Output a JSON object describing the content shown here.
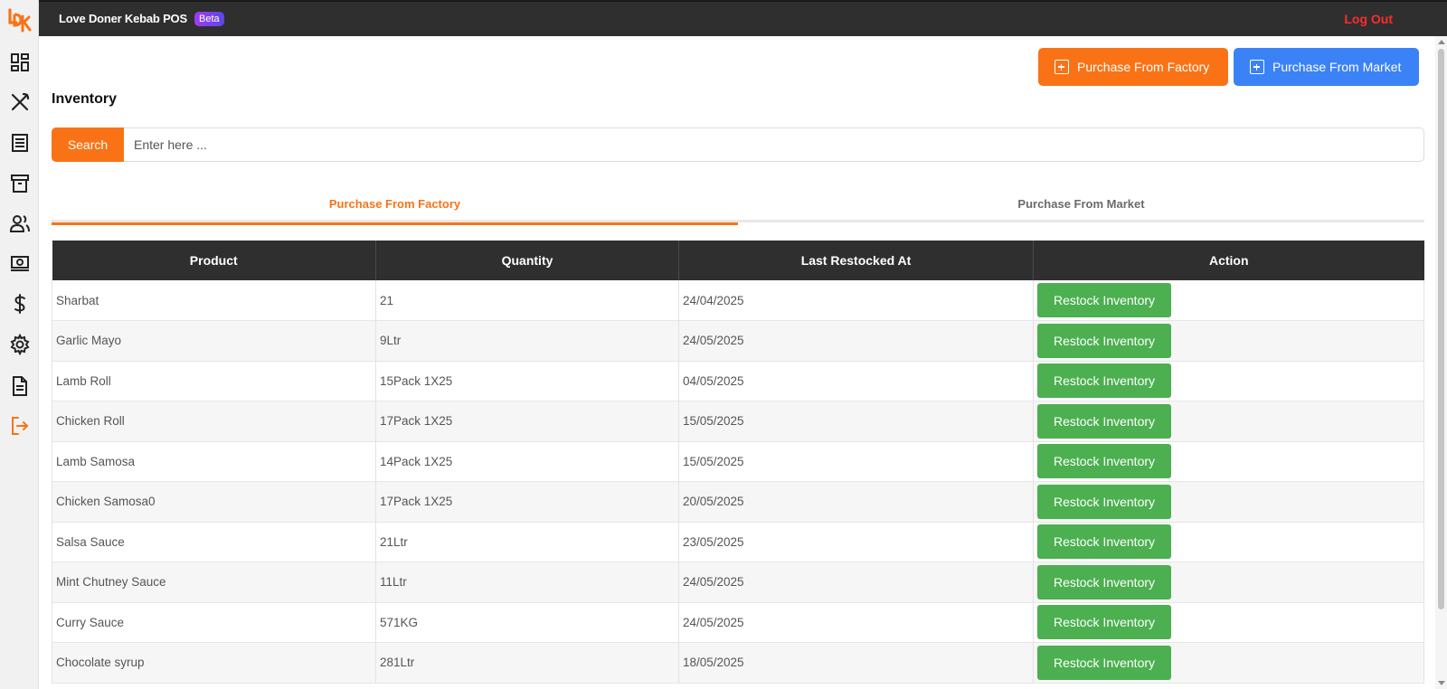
{
  "header": {
    "app_title": "Love Doner Kebab POS",
    "beta_badge": "Beta",
    "logout_label": "Log Out"
  },
  "sidebar": {
    "logo_text": "LDK",
    "icons": [
      "dashboard-icon",
      "utensils-icon",
      "receipt-icon",
      "archive-icon",
      "users-icon",
      "cash-icon",
      "dollar-icon",
      "settings-icon",
      "document-icon",
      "logout-icon"
    ]
  },
  "actions": {
    "purchase_factory": "Purchase From Factory",
    "purchase_market": "Purchase From Market"
  },
  "page": {
    "title": "Inventory"
  },
  "search": {
    "button_label": "Search",
    "placeholder": "Enter here ..."
  },
  "tabs": [
    {
      "label": "Purchase From Factory",
      "active": true
    },
    {
      "label": "Purchase From Market",
      "active": false
    }
  ],
  "table": {
    "headers": [
      "Product",
      "Quantity",
      "Last Restocked At",
      "Action"
    ],
    "rows": [
      {
        "product": "Sharbat",
        "quantity": "21",
        "date": "24/04/2025",
        "action": "Restock Inventory"
      },
      {
        "product": "Garlic Mayo",
        "quantity": "9Ltr",
        "date": "24/05/2025",
        "action": "Restock Inventory"
      },
      {
        "product": "Lamb Roll",
        "quantity": "15Pack 1X25",
        "date": "04/05/2025",
        "action": "Restock Inventory"
      },
      {
        "product": "Chicken Roll",
        "quantity": "17Pack 1X25",
        "date": "15/05/2025",
        "action": "Restock Inventory"
      },
      {
        "product": "Lamb Samosa",
        "quantity": "14Pack 1X25",
        "date": "15/05/2025",
        "action": "Restock Inventory"
      },
      {
        "product": "Chicken Samosa0",
        "quantity": "17Pack 1X25",
        "date": "20/05/2025",
        "action": "Restock Inventory"
      },
      {
        "product": "Salsa Sauce",
        "quantity": "21Ltr",
        "date": "23/05/2025",
        "action": "Restock Inventory"
      },
      {
        "product": "Mint Chutney Sauce",
        "quantity": "11Ltr",
        "date": "24/05/2025",
        "action": "Restock Inventory"
      },
      {
        "product": "Curry Sauce",
        "quantity": "571KG",
        "date": "24/05/2025",
        "action": "Restock Inventory"
      },
      {
        "product": "Chocolate syrup",
        "quantity": "281Ltr",
        "date": "18/05/2025",
        "action": "Restock Inventory"
      }
    ]
  },
  "colors": {
    "accent_orange": "#f97316",
    "accent_blue": "#3b82f6",
    "restock_green": "#4caf50",
    "header_dark": "#2f2f2f",
    "logout_red": "#ff2b2b"
  }
}
